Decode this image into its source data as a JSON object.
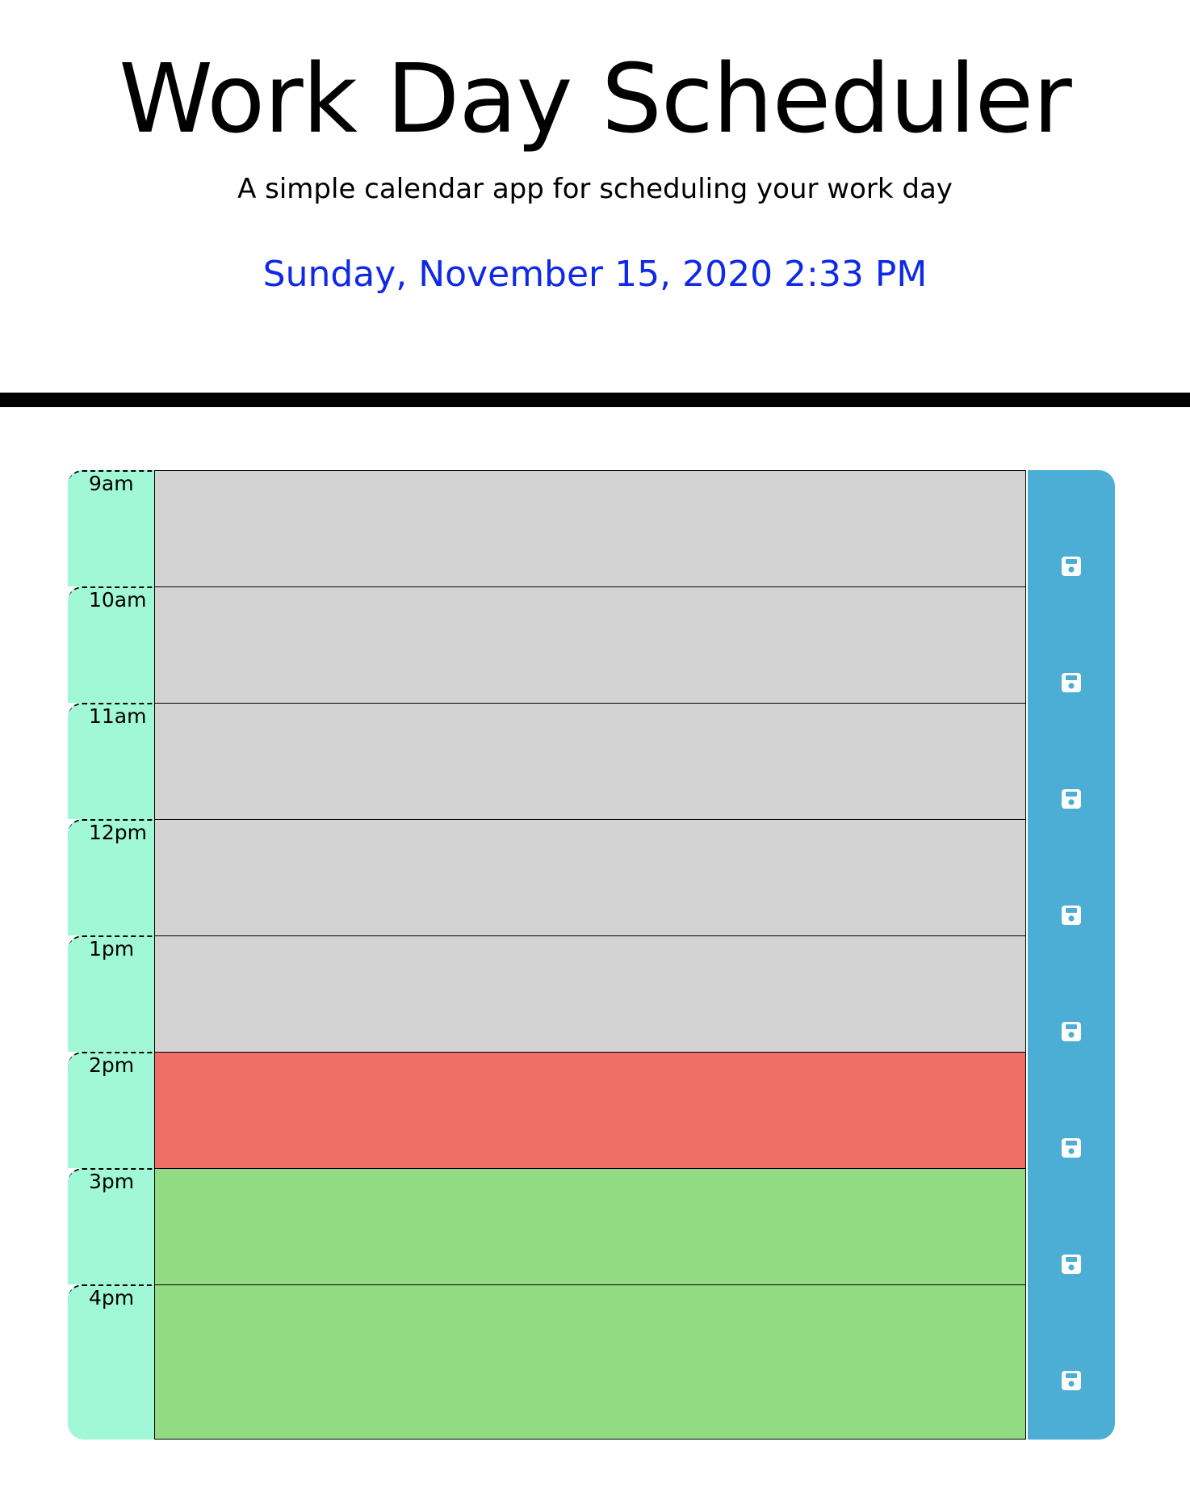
{
  "header": {
    "title": "Work Day Scheduler",
    "subtitle": "A simple calendar app for scheduling your work day",
    "current_datetime": "Sunday, November 15, 2020 2:33 PM"
  },
  "colors": {
    "past": "#d3d3d3",
    "present": "#ef6f67",
    "future": "#93db83",
    "hour_column": "#a0f8d7",
    "save_button": "#4daed5",
    "date_text": "#0f29e6"
  },
  "time_blocks": [
    {
      "hour": "9am",
      "status": "past",
      "text": "",
      "save_icon": "floppy-disk-icon"
    },
    {
      "hour": "10am",
      "status": "past",
      "text": "",
      "save_icon": "floppy-disk-icon"
    },
    {
      "hour": "11am",
      "status": "past",
      "text": "",
      "save_icon": "floppy-disk-icon"
    },
    {
      "hour": "12pm",
      "status": "past",
      "text": "",
      "save_icon": "floppy-disk-icon"
    },
    {
      "hour": "1pm",
      "status": "past",
      "text": "",
      "save_icon": "floppy-disk-icon"
    },
    {
      "hour": "2pm",
      "status": "present",
      "text": "",
      "save_icon": "floppy-disk-icon"
    },
    {
      "hour": "3pm",
      "status": "future",
      "text": "",
      "save_icon": "floppy-disk-icon"
    },
    {
      "hour": "4pm",
      "status": "future",
      "text": "",
      "save_icon": "floppy-disk-icon"
    }
  ]
}
